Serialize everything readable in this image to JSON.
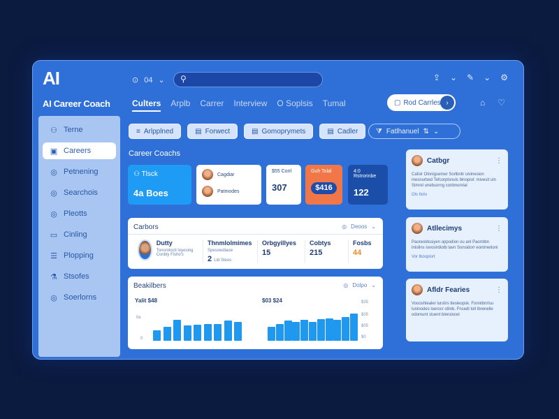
{
  "brand": {
    "logo": "AI",
    "name": "AI Career Coach"
  },
  "sidebar": {
    "items": [
      {
        "label": "Terne",
        "icon": "user-icon"
      },
      {
        "label": "Careers",
        "icon": "briefcase-icon",
        "active": true
      },
      {
        "label": "Petnening",
        "icon": "globe-icon"
      },
      {
        "label": "Searchois",
        "icon": "globe-icon"
      },
      {
        "label": "Pleotts",
        "icon": "globe-icon"
      },
      {
        "label": "Cinling",
        "icon": "folder-icon"
      },
      {
        "label": "Plopping",
        "icon": "list-icon"
      },
      {
        "label": "Stsofes",
        "icon": "flask-icon"
      },
      {
        "label": "Soerlorns",
        "icon": "globe-icon"
      }
    ]
  },
  "header": {
    "controls": [
      "⊙",
      "04",
      "⌄"
    ],
    "search_placeholder": "",
    "tabs": [
      "Culters",
      "Arplb",
      "Carrer",
      "Interview",
      "O Soplsis",
      "Tumal"
    ],
    "button_label": "Rod Carrles"
  },
  "filters": {
    "chips": [
      {
        "label": "Arlpplned",
        "icon": "≡"
      },
      {
        "label": "Forwect",
        "icon": "▤"
      },
      {
        "label": "Gomoprymets",
        "icon": "▤"
      },
      {
        "label": "Cadler",
        "icon": "▤"
      }
    ],
    "wide_label": "Fatlhanuel"
  },
  "section_title": "Career Coachs",
  "stats": {
    "card1": {
      "label": "Tlsck",
      "value": "4a Boes"
    },
    "card2": {
      "row1": "Cagdiar",
      "row2": "Patmodes"
    },
    "card3": {
      "top": "$55 Conl",
      "value": "307"
    },
    "card4": {
      "top": "Guh Tolal",
      "value": "$416"
    },
    "card5": {
      "top": "4:0 Rstrorinbe",
      "value": "122"
    }
  },
  "careers": {
    "title": "Carbors",
    "control": "Deoos",
    "columns": [
      {
        "label": "Dutty",
        "sub": "Tonorolocti loyesing Conbly Fisho's",
        "avatar": true
      },
      {
        "label": "Thnmlolmimes",
        "sub": "Spesowdiaoe",
        "value": "2",
        "value_suffix": "Lid Steos"
      },
      {
        "label": "Orbgyillyes",
        "sub": "",
        "value": "15"
      },
      {
        "label": "Cobtys",
        "sub": "",
        "value": "215"
      },
      {
        "label": "Fosbs",
        "sub": "",
        "value": "44",
        "orange": true
      }
    ]
  },
  "bars": {
    "title": "Beakilbers",
    "control": "Dolpo",
    "left": {
      "label": "Yalit $48",
      "ticks": [
        "0e",
        "0"
      ],
      "values": [
        0.45,
        0.58,
        0.88,
        0.65,
        0.68,
        0.7,
        0.72,
        0.85,
        0.8
      ]
    },
    "right": {
      "label": "$03 $24",
      "ticks": [
        "$35",
        "$05",
        "$05",
        "$0"
      ],
      "values": [
        0.6,
        0.72,
        0.85,
        0.78,
        0.88,
        0.8,
        0.9,
        0.95,
        0.87,
        1.0,
        1.15
      ]
    }
  },
  "right_cards": [
    {
      "title": "Catbgr",
      "body": "Cafoir Olnnigsemer Sorlbnlir ulvinesion mesnurbed Tefcorptsnuls blnopiol: mivesit uln Simrel unebsorng conbnunrial",
      "link": "Ols Itolu"
    },
    {
      "title": "Atllecimys",
      "body": "Paoreoldssiyen oppodion ou anl Paomtbn intolins luvoslrdiotb lavn Sonsidorr eontmetionl",
      "link": "Vor lboopiort"
    },
    {
      "title": "Afldr Fearies",
      "body": "Voooshlealer lurslirs tlesleopsk. Fonntbnrlsu luninodes loerocr stlinb. Fncedl Ioll Ibrenelle odomunt stuent blerulocel",
      "link": ""
    }
  ]
}
